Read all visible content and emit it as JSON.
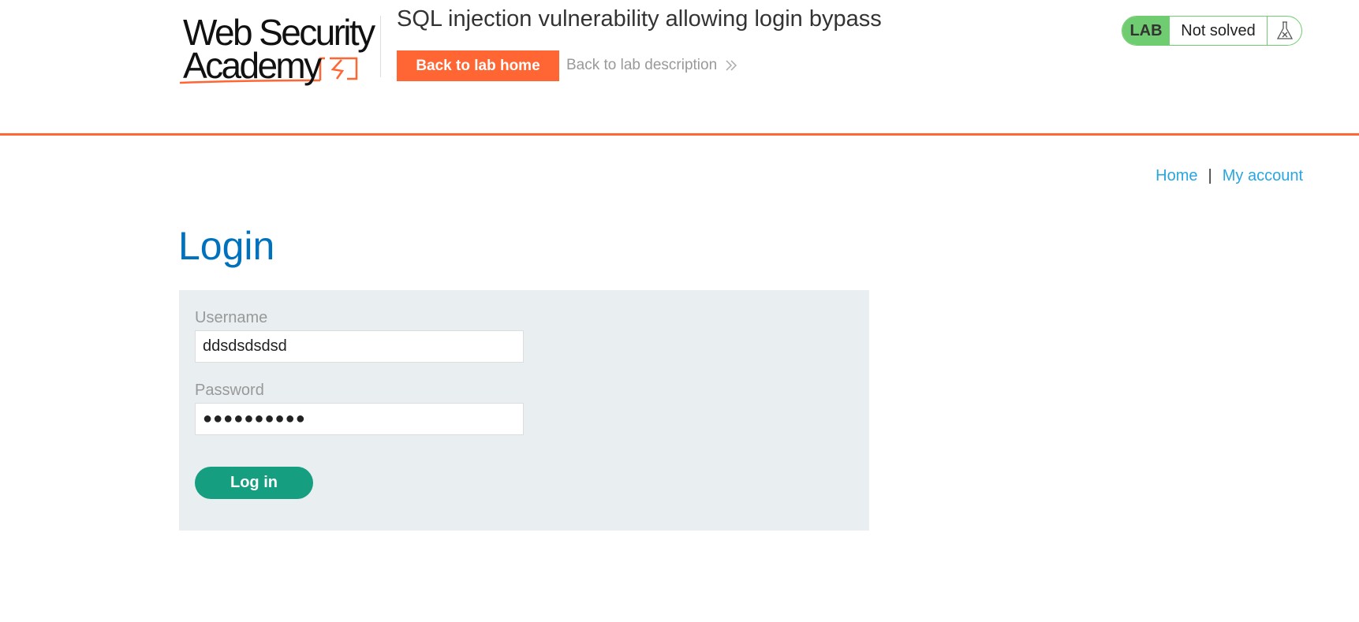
{
  "header": {
    "logo": {
      "line1": "Web Security",
      "line2": "Academy"
    },
    "lab_title": "SQL injection vulnerability allowing login bypass",
    "back_to_lab_home": "Back to lab home",
    "back_to_lab_description": "Back to lab description",
    "lab_badge": "LAB",
    "lab_status": "Not solved",
    "icons": {
      "description_link": "double-chevron-right-icon",
      "status": "flask-icon"
    },
    "colors": {
      "accent": "#ff6633",
      "lab_green": "#70cc70"
    }
  },
  "nav": {
    "home": "Home",
    "separator": "|",
    "my_account": "My account",
    "link_color": "#29a6e0"
  },
  "login": {
    "heading": "Login",
    "username_label": "Username",
    "username_value": "ddsdsdsdsd",
    "password_label": "Password",
    "password_value": "●●●●●●●●●●",
    "submit_label": "Log in",
    "colors": {
      "heading": "#0071bc",
      "button": "#159e80",
      "panel": "#e9eef1"
    }
  }
}
